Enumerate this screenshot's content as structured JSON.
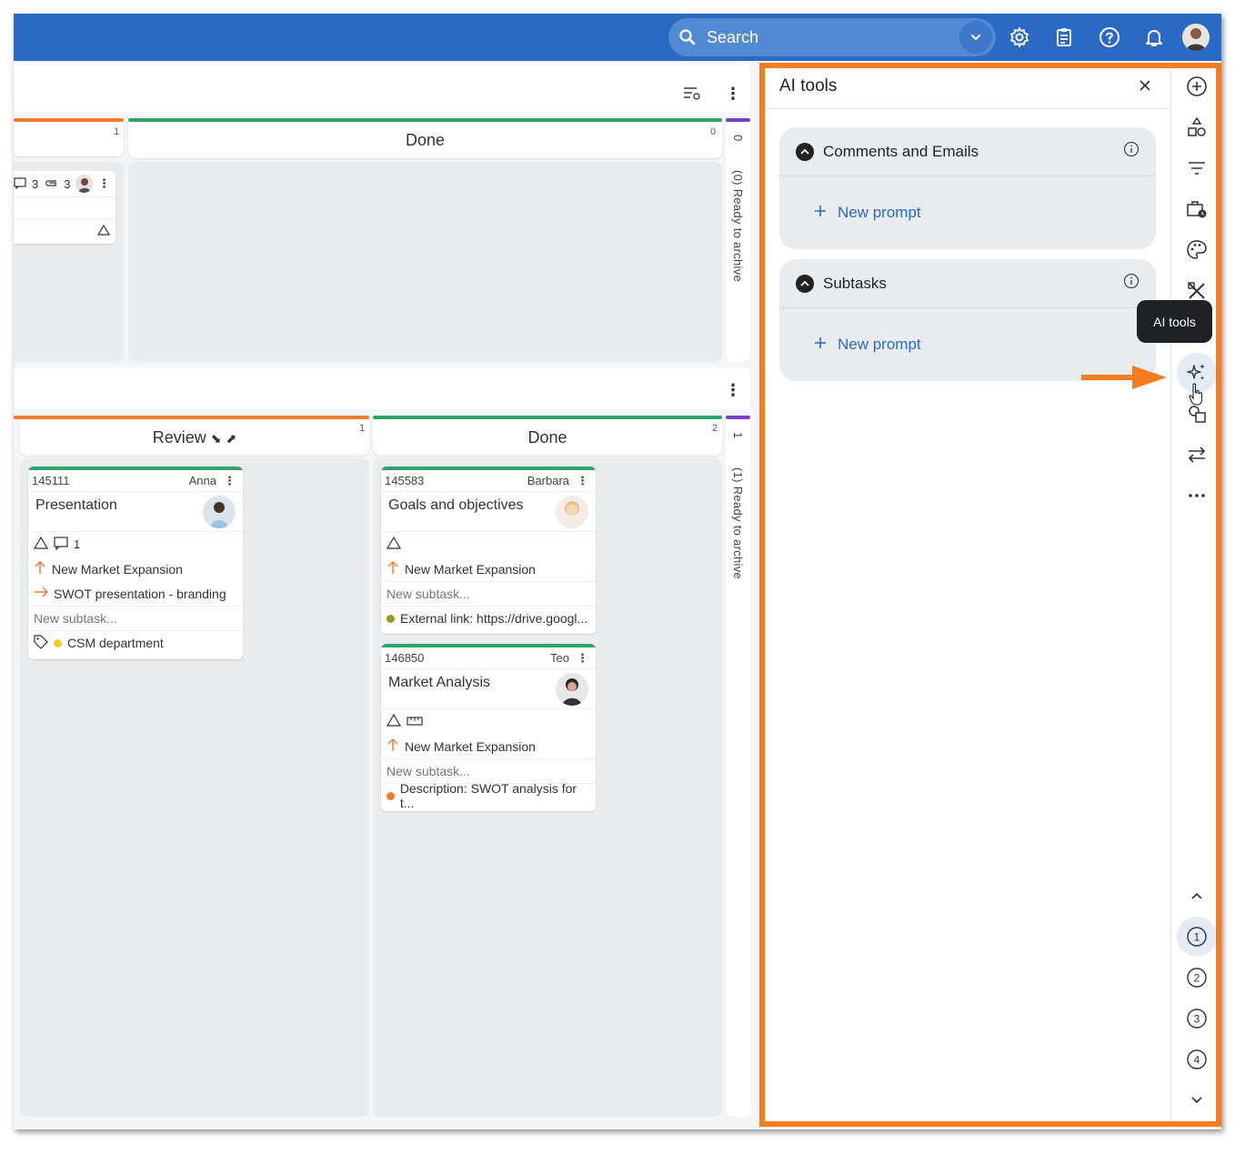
{
  "topbar": {
    "search_placeholder": "Search",
    "icons": [
      "search-icon",
      "chevron-down-icon",
      "gear-icon",
      "clipboard-icon",
      "help-icon",
      "bell-icon",
      "avatar"
    ]
  },
  "board": {
    "upper_lane": {
      "left_col_count": "1",
      "done_label": "Done",
      "done_count": "0",
      "ready_count": "0",
      "ready_label": "(0)  Ready to archive",
      "partial_card": {
        "comments": "3",
        "attachments": "3"
      }
    },
    "lower_lane": {
      "review_label": "Review",
      "review_count": "1",
      "done_label": "Done",
      "done_count": "2",
      "ready_count": "1",
      "ready_label": "(1)  Ready to archive",
      "review_cards": [
        {
          "id": "145111",
          "owner": "Anna",
          "title": "Presentation",
          "comment_count": "1",
          "parent": "New Market Expansion",
          "linked": "SWOT presentation - branding",
          "subtask_placeholder": "New subtask...",
          "tag": "CSM department"
        }
      ],
      "done_cards": [
        {
          "id": "145583",
          "owner": "Barbara",
          "title": "Goals and objectives",
          "parent": "New Market Expansion",
          "subtask_placeholder": "New subtask...",
          "extra": "External link: https://drive.googl..."
        },
        {
          "id": "146850",
          "owner": "Teo",
          "title": "Market Analysis",
          "parent": "New Market Expansion",
          "subtask_placeholder": "New subtask...",
          "extra": "Description: SWOT analysis for t..."
        }
      ]
    }
  },
  "ai_panel": {
    "title": "AI tools",
    "sections": [
      {
        "title": "Comments and Emails",
        "new_prompt": "New prompt"
      },
      {
        "title": "Subtasks",
        "new_prompt": "New prompt"
      }
    ]
  },
  "rail": {
    "tooltip": "AI tools",
    "pages": [
      "1",
      "2",
      "3",
      "4"
    ]
  },
  "colors": {
    "topbar": "#2a6ac4",
    "highlight": "#f57c1f",
    "green": "#2fa36b",
    "orange": "#ee7d30",
    "purple": "#7a3fc2",
    "link": "#2a6ac4"
  }
}
